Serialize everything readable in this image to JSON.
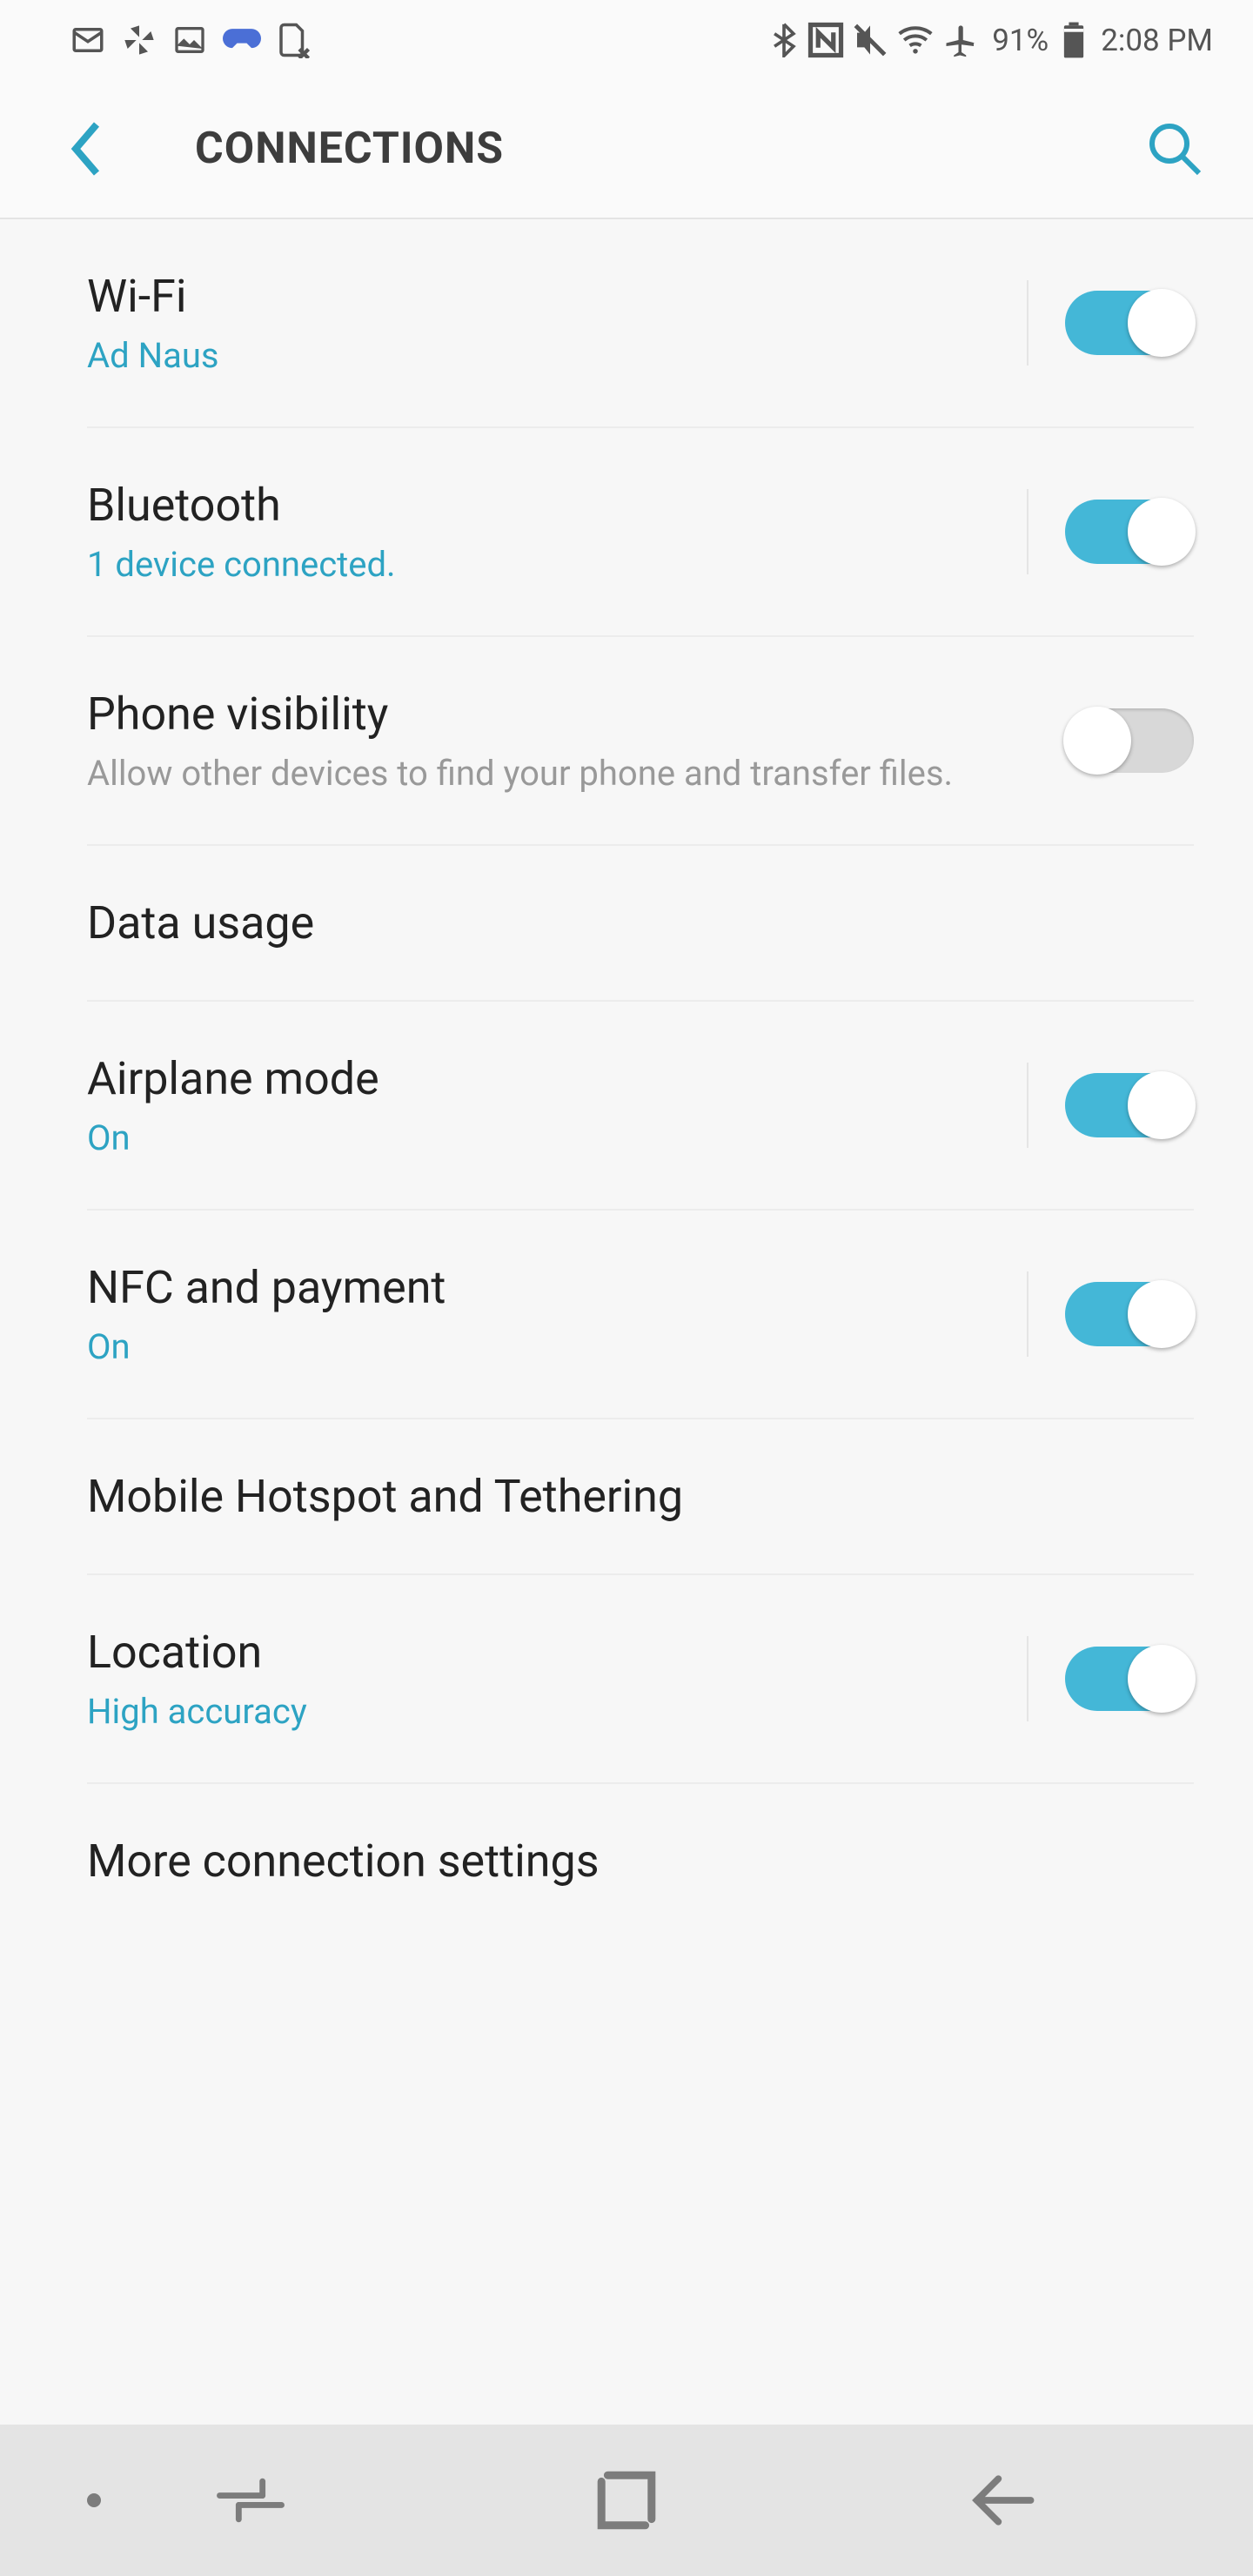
{
  "statusBar": {
    "battery": "91%",
    "clock": "2:08 PM"
  },
  "appBar": {
    "title": "CONNECTIONS"
  },
  "items": {
    "wifi": {
      "title": "Wi-Fi",
      "sub": "Ad Naus",
      "on": true
    },
    "bluetooth": {
      "title": "Bluetooth",
      "sub": "1 device connected.",
      "on": true
    },
    "visibility": {
      "title": "Phone visibility",
      "sub": "Allow other devices to find your phone and transfer files.",
      "on": false
    },
    "data": {
      "title": "Data usage"
    },
    "airplane": {
      "title": "Airplane mode",
      "sub": "On",
      "on": true
    },
    "nfc": {
      "title": "NFC and payment",
      "sub": "On",
      "on": true
    },
    "hotspot": {
      "title": "Mobile Hotspot and Tethering"
    },
    "location": {
      "title": "Location",
      "sub": "High accuracy",
      "on": true
    },
    "more": {
      "title": "More connection settings"
    }
  }
}
